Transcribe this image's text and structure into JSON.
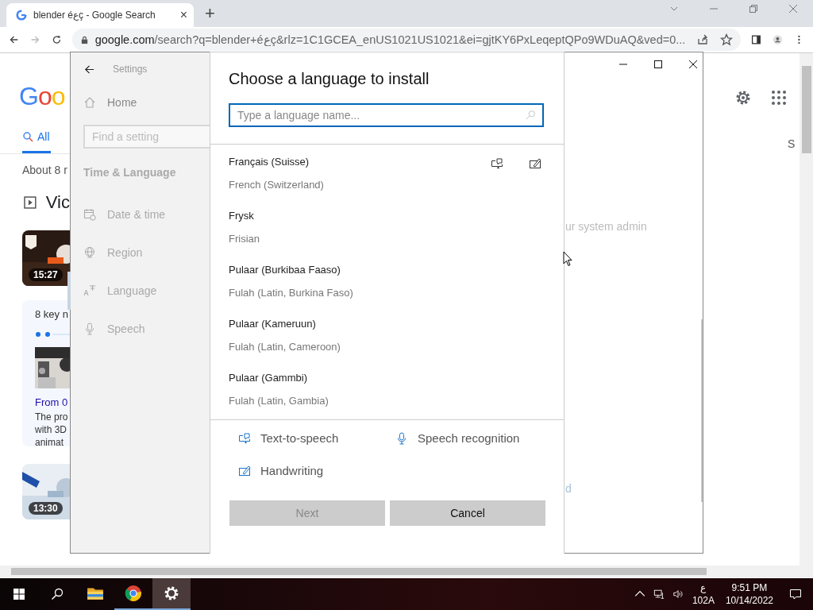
{
  "browser": {
    "tab": {
      "title": "blender éعç - Google Search",
      "close": "×"
    },
    "new_tab": "+",
    "url": {
      "domain": "google.com",
      "path": "/search?q=blender+éعç&rlz=1C1GCEA_enUS1021US1021&ei=gjtKY6PxLeqeptQPo9WDuAQ&ved=0..."
    }
  },
  "google": {
    "logo": "Goo",
    "tabs": [
      {
        "label": "All",
        "selected": true
      }
    ],
    "result_count": "About 8 r",
    "section_title": "Vic",
    "videos": [
      {
        "duration": "15:27",
        "kind": "picture"
      },
      {
        "duration": "13:30",
        "kind": "picture"
      }
    ],
    "key_moments": {
      "title": "8 key n",
      "link": "From 0",
      "snippet": "The pro\nwith 3D\nanimat"
    },
    "edge_text": "S"
  },
  "settings": {
    "title": "Settings",
    "home": "Home",
    "search_placeholder": "Find a setting",
    "section": "Time & Language",
    "nav": [
      {
        "label": "Date & time",
        "selected": false
      },
      {
        "label": "Region",
        "selected": false
      },
      {
        "label": "Language",
        "selected": true
      },
      {
        "label": "Speech",
        "selected": false
      }
    ],
    "background_texts": [
      "ur system admin",
      "d"
    ]
  },
  "dialog": {
    "title": "Choose a language to install",
    "search_placeholder": "Type a language name...",
    "languages": [
      {
        "name": "Français (Suisse)",
        "english": "French (Switzerland)",
        "text_to_speech": true,
        "handwriting": true
      },
      {
        "name": "Frysk",
        "english": "Frisian",
        "text_to_speech": false,
        "handwriting": false
      },
      {
        "name": "Pulaar (Burkibaa Faaso)",
        "english": "Fulah (Latin, Burkina Faso)",
        "text_to_speech": false,
        "handwriting": false
      },
      {
        "name": "Pulaar (Kameruun)",
        "english": "Fulah (Latin, Cameroon)",
        "text_to_speech": false,
        "handwriting": false
      },
      {
        "name": "Pulaar (Gammbi)",
        "english": "Fulah (Latin, Gambia)",
        "text_to_speech": false,
        "handwriting": false
      }
    ],
    "legend": [
      {
        "kind": "tts",
        "label": "Text-to-speech"
      },
      {
        "kind": "speech",
        "label": "Speech recognition"
      },
      {
        "kind": "handwriting",
        "label": "Handwriting"
      }
    ],
    "buttons": [
      {
        "label": "Next",
        "disabled": true
      },
      {
        "label": "Cancel",
        "disabled": false
      }
    ]
  },
  "taskbar": {
    "apps": [
      {
        "kind": "explorer",
        "running": false,
        "selected": false
      },
      {
        "kind": "chrome",
        "running": true,
        "selected": false
      },
      {
        "kind": "settings",
        "running": true,
        "selected": true
      }
    ],
    "input_language": "ع",
    "keyboard": "102A",
    "time": "9:51 PM",
    "date": "10/14/2022"
  }
}
